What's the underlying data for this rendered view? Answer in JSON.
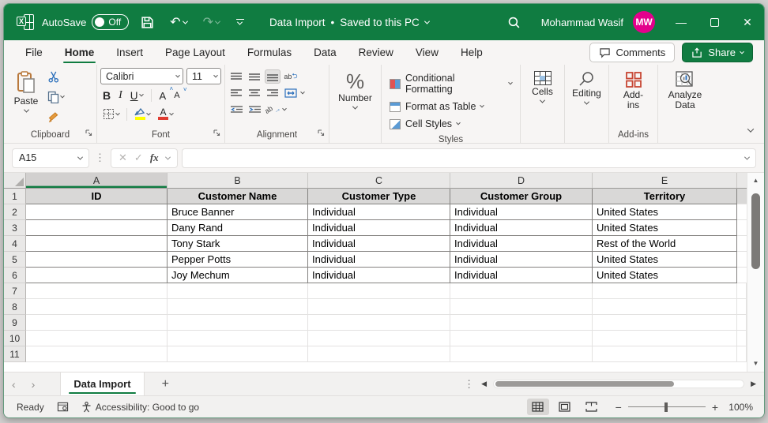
{
  "titlebar": {
    "autosave_label": "AutoSave",
    "autosave_state": "Off",
    "doc_title": "Data Import",
    "doc_sep": "•",
    "doc_status": "Saved to this PC",
    "user_name": "Mohammad Wasif",
    "user_initials": "MW"
  },
  "menu_tabs": [
    "File",
    "Home",
    "Insert",
    "Page Layout",
    "Formulas",
    "Data",
    "Review",
    "View",
    "Help"
  ],
  "active_tab": "Home",
  "top_right": {
    "comments": "Comments",
    "share": "Share"
  },
  "ribbon": {
    "paste": "Paste",
    "font_name": "Calibri",
    "font_size": "11",
    "number": "Number",
    "styles": [
      "Conditional Formatting",
      "Format as Table",
      "Cell Styles"
    ],
    "cells": "Cells",
    "editing": "Editing",
    "addins": "Add-ins",
    "analyze": "Analyze Data",
    "groups": {
      "clipboard": "Clipboard",
      "font": "Font",
      "alignment": "Alignment",
      "styles": "Styles",
      "addins": "Add-ins"
    }
  },
  "formula_bar": {
    "name_box": "A15",
    "formula": ""
  },
  "grid": {
    "columns": [
      "A",
      "B",
      "C",
      "D",
      "E"
    ],
    "selected_column": "A",
    "rows": [
      {
        "n": 1,
        "header": true,
        "cells": [
          "ID",
          "Customer Name",
          "Customer Type",
          "Customer Group",
          "Territory"
        ]
      },
      {
        "n": 2,
        "header": false,
        "cells": [
          "",
          "Bruce Banner",
          "Individual",
          "Individual",
          "United States"
        ]
      },
      {
        "n": 3,
        "header": false,
        "cells": [
          "",
          "Dany Rand",
          "Individual",
          "Individual",
          "United States"
        ]
      },
      {
        "n": 4,
        "header": false,
        "cells": [
          "",
          "Tony Stark",
          "Individual",
          "Individual",
          "Rest of the World"
        ]
      },
      {
        "n": 5,
        "header": false,
        "cells": [
          "",
          "Pepper Potts",
          "Individual",
          "Individual",
          "United States"
        ]
      },
      {
        "n": 6,
        "header": false,
        "cells": [
          "",
          "Joy Mechum",
          "Individual",
          "Individual",
          "United States"
        ]
      },
      {
        "n": 7,
        "header": false,
        "cells": [
          "",
          "",
          "",
          "",
          ""
        ]
      },
      {
        "n": 8,
        "header": false,
        "cells": [
          "",
          "",
          "",
          "",
          ""
        ]
      },
      {
        "n": 9,
        "header": false,
        "cells": [
          "",
          "",
          "",
          "",
          ""
        ]
      },
      {
        "n": 10,
        "header": false,
        "cells": [
          "",
          "",
          "",
          "",
          ""
        ]
      },
      {
        "n": 11,
        "header": false,
        "cells": [
          "",
          "",
          "",
          "",
          ""
        ]
      }
    ]
  },
  "sheet_bar": {
    "active_sheet": "Data Import"
  },
  "status_bar": {
    "ready": "Ready",
    "accessibility": "Accessibility: Good to go",
    "zoom_level": "100%"
  },
  "icons": {
    "minimize": "—",
    "close": "✕",
    "undo": "↶",
    "redo": "↷",
    "cancel": "✕",
    "enter": "✓",
    "fx": "fx",
    "percent": "%",
    "bold": "B",
    "italic": "I",
    "underline": "U",
    "font_letter": "A",
    "wrap_ab": "ab",
    "sheet_prev": "‹",
    "sheet_next": "›",
    "add_sheet": "+",
    "dots": "⋮",
    "left": "◀",
    "right": "▶",
    "up": "▲",
    "down": "▼",
    "zoom_out": "−",
    "zoom_in": "+"
  },
  "colors": {
    "accent_green": "#107C41",
    "avatar_pink": "#E3008C",
    "fill_yellow": "#ffff00",
    "font_red": "#e03c31"
  }
}
